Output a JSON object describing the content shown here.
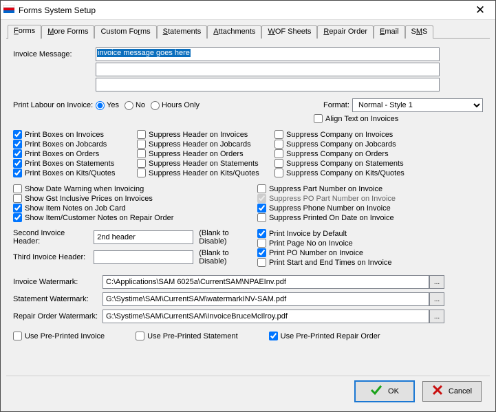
{
  "window": {
    "title": "Forms System Setup"
  },
  "tabs": [
    "Forms",
    "More Forms",
    "Custom Forms",
    "Statements",
    "Attachments",
    "WOF Sheets",
    "Repair Order",
    "Email",
    "SMS"
  ],
  "invoiceMessage": {
    "label": "Invoice Message:",
    "line1": "invoice message goes here",
    "line2": "",
    "line3": ""
  },
  "printLabour": {
    "label": "Print Labour on Invoice:",
    "opt1": "Yes",
    "opt2": "No",
    "opt3": "Hours Only"
  },
  "format": {
    "label": "Format:",
    "value": "Normal - Style 1"
  },
  "alignText": "Align Text on Invoices",
  "col1": [
    "Print Boxes on Invoices",
    "Print Boxes on Jobcards",
    "Print Boxes on Orders",
    "Print Boxes on Statements",
    "Print Boxes on Kits/Quotes"
  ],
  "col2": [
    "Suppress Header on Invoices",
    "Suppress Header on Jobcards",
    "Suppress Header on Orders",
    "Suppress Header on Statements",
    "Suppress Header on Kits/Quotes"
  ],
  "col3": [
    "Suppress Company on Invoices",
    "Suppress Company on Jobcards",
    "Suppress Company on Orders",
    "Suppress Company on Statements",
    "Suppress Company on Kits/Quotes"
  ],
  "left2": [
    "Show Date Warning when Invoicing",
    "Show Gst Inclusive Prices on Invoices",
    "Show Item Notes on Job Card",
    "Show Item/Customer Notes on Repair Order"
  ],
  "right2": [
    "Suppress Part Number on Invoice",
    "Suppress PO Part Number on Invoice",
    "Suppress Phone Number on Invoice",
    "Suppress Printed On Date on Invoice"
  ],
  "right3": [
    "Print Invoice by Default",
    "Print Page No on Invoice",
    "Print PO Number on Invoice",
    "Print Start and End Times on Invoice"
  ],
  "secondHdr": {
    "label": "Second Invoice Header:",
    "value": "2nd header",
    "hint": "(Blank to Disable)"
  },
  "thirdHdr": {
    "label": "Third Invoice Header:",
    "value": "",
    "hint": "(Blank to Disable)"
  },
  "wm": {
    "invoice": {
      "label": "Invoice Watermark:",
      "value": "C:\\Applications\\SAM 6025a\\CurrentSAM\\NPAEInv.pdf"
    },
    "statement": {
      "label": "Statement Watermark:",
      "value": "G:\\Systime\\SAM\\CurrentSAM\\watermarkINV-SAM.pdf"
    },
    "repair": {
      "label": "Repair Order Watermark:",
      "value": "G:\\Systime\\SAM\\CurrentSAM\\InvoiceBruceMcIlroy.pdf"
    }
  },
  "usePre": {
    "invoice": "Use Pre-Printed Invoice",
    "statement": "Use Pre-Printed Statement",
    "repair": "Use Pre-Printed Repair Order"
  },
  "buttons": {
    "ok": "OK",
    "cancel": "Cancel"
  },
  "browse": "..."
}
